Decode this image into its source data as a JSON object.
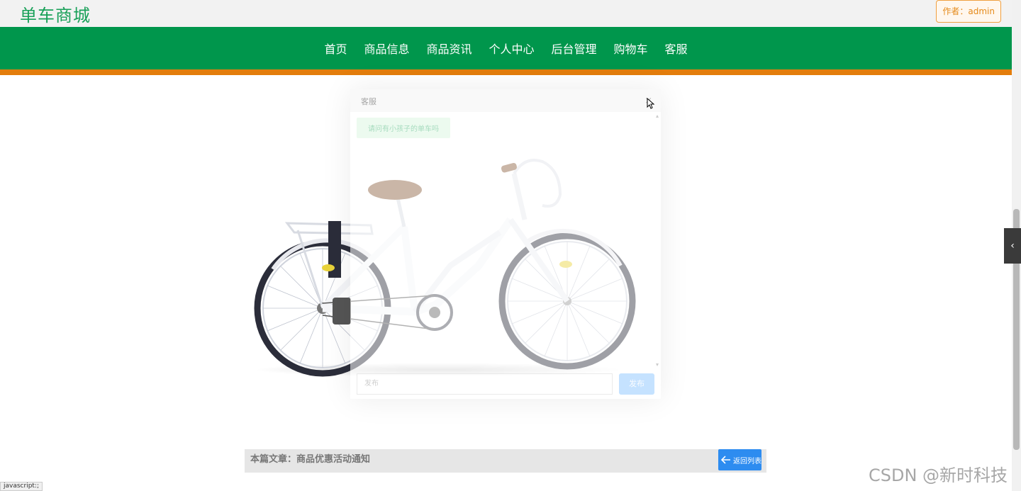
{
  "brand": "单车商城",
  "author_badge": "作者：admin",
  "nav": {
    "items": [
      "首页",
      "商品信息",
      "商品资讯",
      "个人中心",
      "后台管理",
      "购物车",
      "客服"
    ]
  },
  "chat_dialog": {
    "title": "客服",
    "message": "请问有小孩子的单车吗",
    "input_placeholder": "发布",
    "send_label": "发布"
  },
  "article": {
    "label": "本篇文章：商品优惠活动通知",
    "back_button": "返回列表"
  },
  "status_url": "javascript:;",
  "watermark": "CSDN @新时科技",
  "colors": {
    "brand_green": "#18a058",
    "nav_green": "#00964c",
    "accent_orange": "#e37d0c",
    "button_blue": "#2d8cf0"
  }
}
